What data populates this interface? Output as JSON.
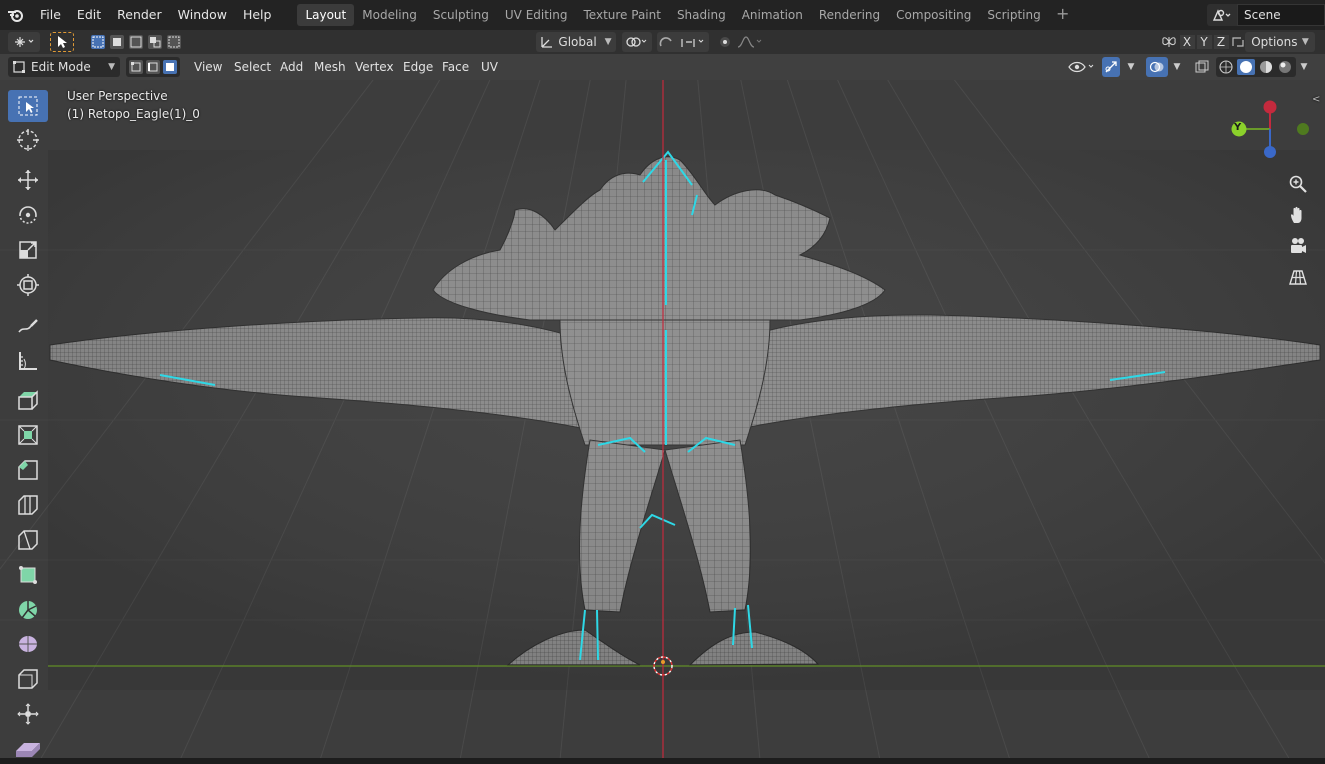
{
  "topbar": {
    "menus": [
      "File",
      "Edit",
      "Render",
      "Window",
      "Help"
    ],
    "workspaces": [
      "Layout",
      "Modeling",
      "Sculpting",
      "UV Editing",
      "Texture Paint",
      "Shading",
      "Animation",
      "Rendering",
      "Compositing",
      "Scripting"
    ],
    "active_workspace": "Layout",
    "add_label": "+",
    "scene_name": "Scene"
  },
  "toolheader": {
    "transform_orientation": "Global",
    "axes": [
      "X",
      "Y",
      "Z"
    ],
    "options_label": "Options"
  },
  "vpheader": {
    "mode": "Edit Mode",
    "menus": [
      "View",
      "Select",
      "Add",
      "Mesh",
      "Vertex",
      "Edge",
      "Face",
      "UV"
    ]
  },
  "viewport": {
    "view_name": "User Perspective",
    "object_name": "(1) Retopo_Eagle(1)_0"
  },
  "gizmo": {
    "y_label": "Y"
  },
  "colors": {
    "accent": "#4772b3",
    "axis_red": "#c42a3d",
    "axis_green": "#6a9a2a",
    "seam": "#2ed8e6"
  },
  "icons": {
    "toolbar": [
      "select-box-icon",
      "cursor-icon",
      "move-icon",
      "rotate-icon",
      "scale-icon",
      "transform-icon",
      "annotate-icon",
      "measure-icon",
      "extrude-icon",
      "inset-icon",
      "bevel-icon",
      "loop-cut-icon",
      "knife-icon",
      "poly-build-icon",
      "spin-icon",
      "smooth-icon",
      "edge-slide-icon",
      "shrink-fatten-icon",
      "shear-icon"
    ],
    "nav": [
      "zoom-icon",
      "pan-hand-icon",
      "camera-icon",
      "ortho-grid-icon"
    ]
  }
}
